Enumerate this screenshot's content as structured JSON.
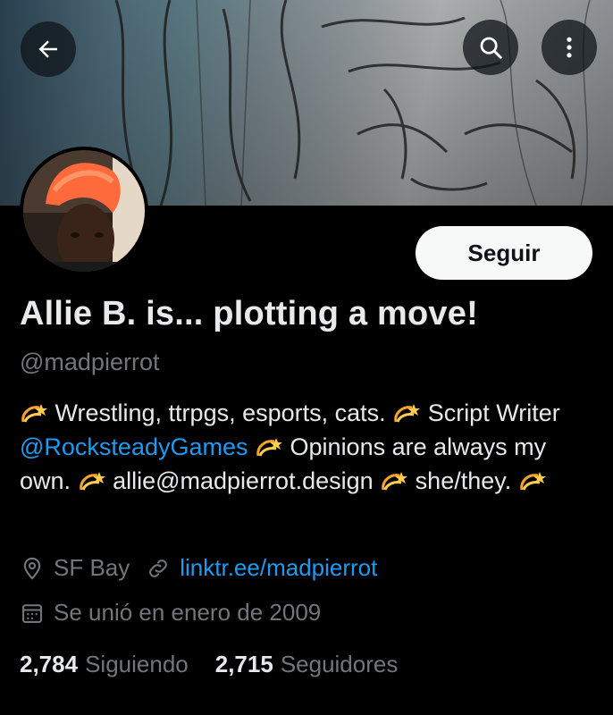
{
  "header": {
    "back_icon": "arrow-left-icon",
    "search_icon": "search-icon",
    "more_icon": "more-vertical-icon"
  },
  "profile": {
    "follow_label": "Seguir",
    "display_name": "Allie B. is... plotting a move!",
    "handle": "@madpierrot",
    "bio": {
      "segment1": "Wrestling, ttrpgs, esports, cats.",
      "segment2": "Script Writer",
      "mention": "@RocksteadyGames",
      "segment3": "Opinions are always my own.",
      "segment4": "allie@madpierrot.design",
      "segment5": "she/they.",
      "emoji_name": "dizzy-emoji"
    },
    "location": "SF Bay",
    "website": "linktr.ee/madpierrot",
    "joined": "Se unió en enero de 2009",
    "following_count": "2,784",
    "following_label": "Siguiendo",
    "followers_count": "2,715",
    "followers_label": "Seguidores"
  },
  "colors": {
    "background": "#000000",
    "accent": "#1d9bf0",
    "text_primary": "#e7e9ea",
    "text_secondary": "#71767b",
    "follow_button_bg": "#f7f9f9"
  }
}
